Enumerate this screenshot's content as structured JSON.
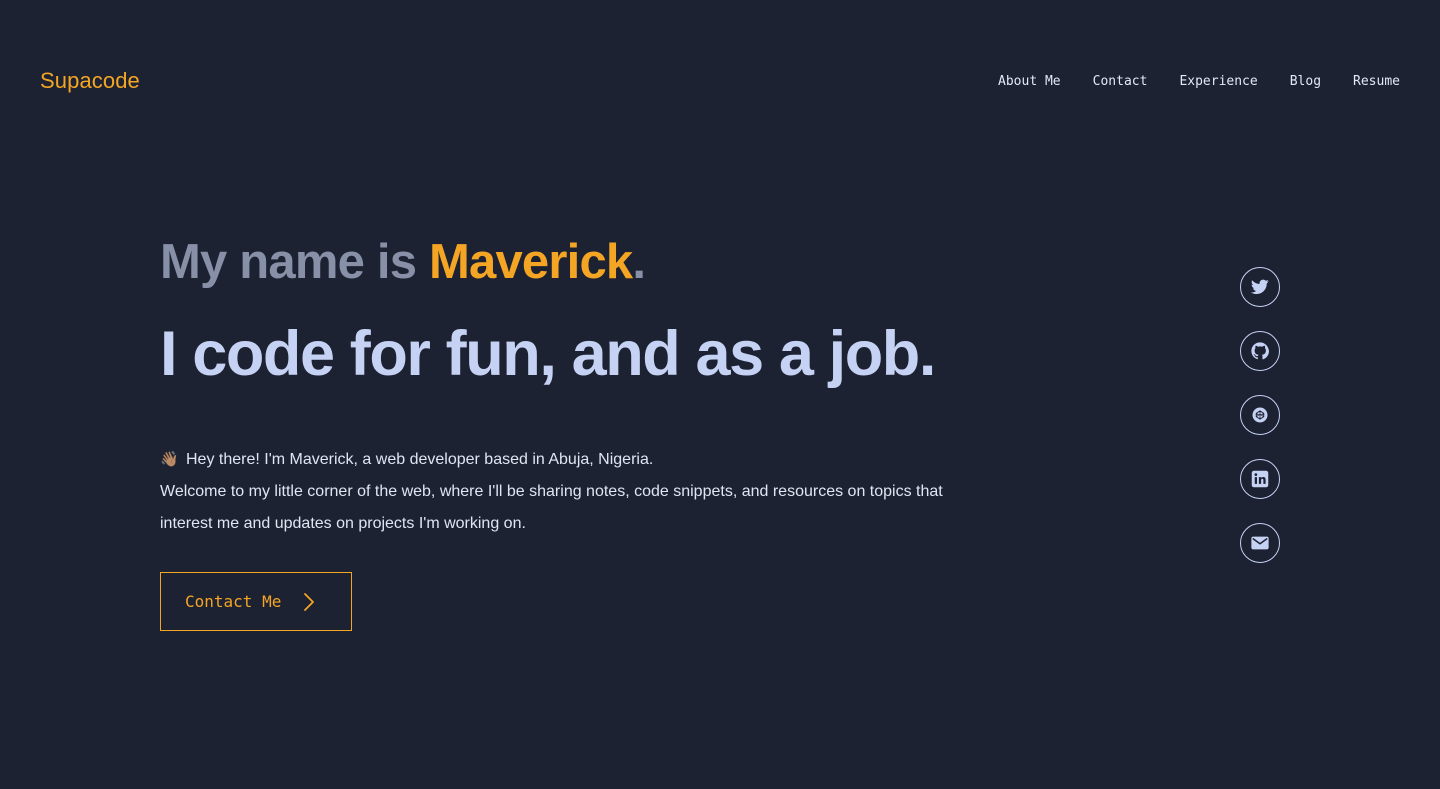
{
  "header": {
    "logo": "Supacode",
    "nav": [
      "About Me",
      "Contact",
      "Experience",
      "Blog",
      "Resume"
    ]
  },
  "hero": {
    "intro_prefix": "My name is ",
    "intro_name": "Maverick",
    "intro_suffix": ".",
    "headline": "I code for fun, and as a job.",
    "wave_emoji": "👋🏽",
    "line1": "Hey there! I'm Maverick, a web developer based in Abuja, Nigeria.",
    "line2": "Welcome to my little corner of the web, where I'll be sharing notes, code snippets, and resources on topics that interest me and updates on projects I'm working on.",
    "cta_label": "Contact Me"
  },
  "socials": [
    "twitter-icon",
    "github-icon",
    "codepen-icon",
    "linkedin-icon",
    "mail-icon"
  ],
  "colors": {
    "background": "#1c2232",
    "accent": "#f5a524",
    "headline": "#c6d2f4",
    "muted": "#8890a8",
    "text": "#dfe5f3"
  }
}
